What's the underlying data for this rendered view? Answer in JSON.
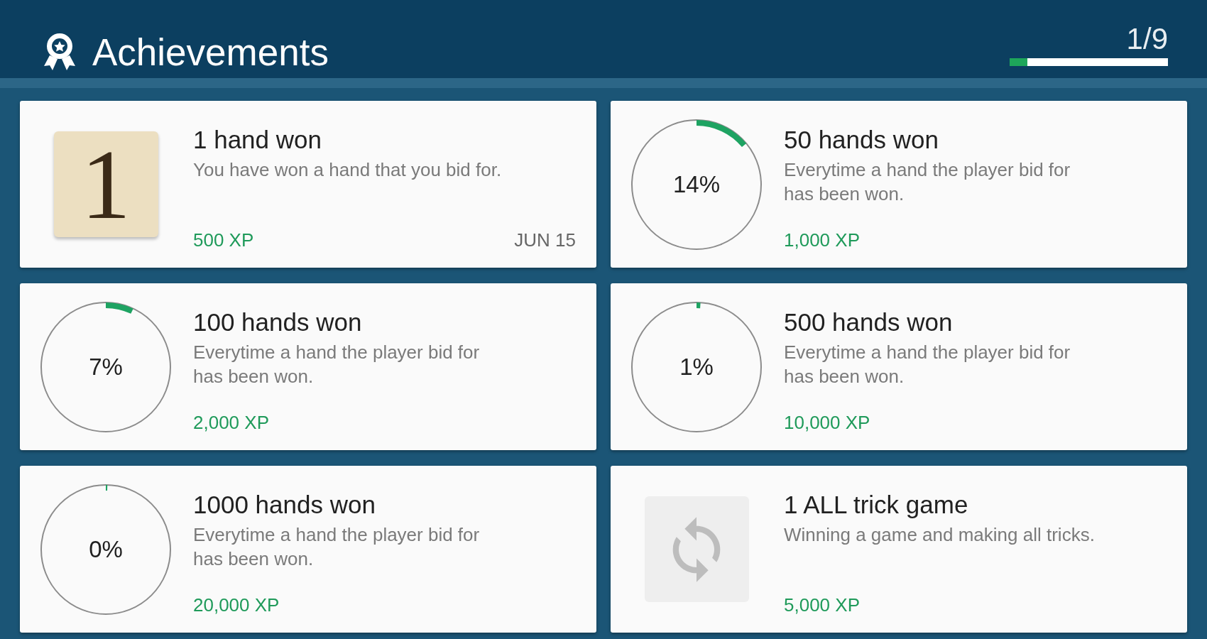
{
  "header": {
    "title": "Achievements",
    "progress": {
      "text": "1/9",
      "level": 0.11
    }
  },
  "achievements": [
    {
      "kind": "unlocked",
      "badge": "1",
      "title": "1 hand won",
      "description": "You have won a hand that you bid for.",
      "xp": "500 XP",
      "date": "JUN 15"
    },
    {
      "kind": "progress",
      "percent": "14%",
      "level": 0.14,
      "title": "50 hands won",
      "description": "Everytime a hand the player bid for has been won.",
      "xp": "1,000 XP"
    },
    {
      "kind": "progress",
      "percent": "7%",
      "level": 0.07,
      "title": "100 hands won",
      "description": "Everytime a hand the player bid for has been won.",
      "xp": "2,000 XP"
    },
    {
      "kind": "progress",
      "percent": "1%",
      "level": 0.01,
      "title": "500 hands won",
      "description": "Everytime a hand the player bid for has been won.",
      "xp": "10,000 XP"
    },
    {
      "kind": "progress",
      "percent": "0%",
      "level": 0,
      "title": "1000 hands won",
      "description": "Everytime a hand the player bid for has been won.",
      "xp": "20,000 XP"
    },
    {
      "kind": "locked",
      "title": "1 ALL trick game",
      "description": "Winning a game and making all tricks.",
      "xp": "5,000 XP"
    }
  ]
}
